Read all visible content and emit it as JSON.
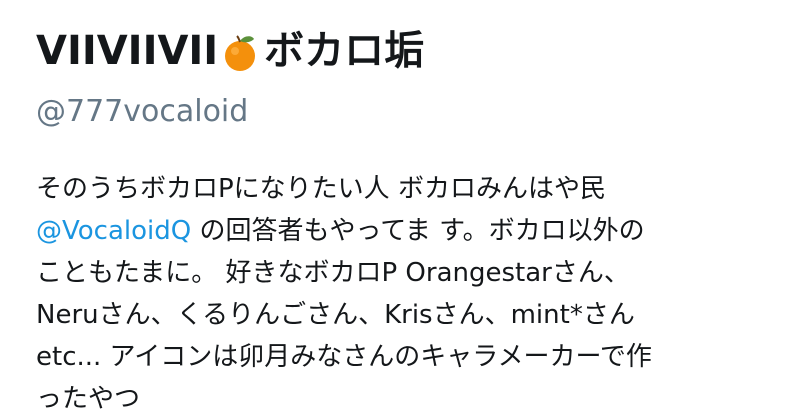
{
  "profile": {
    "name_prefix": "VIIVIIVII",
    "name_suffix": "ボカロ垢",
    "name_emoji": "orange-emoji",
    "handle": "@777vocaloid"
  },
  "bio": {
    "line1": "そのうちボカロPになりたい人 ボカロみんはや民",
    "line2_mention": "@VocaloidQ",
    "line2_rest": " の回答者もやってま す。ボカロ以外の",
    "line3": "こともたまに。 好きなボカロP Orangestarさん、",
    "line4": "Neruさん、くるりんごさん、Krisさん、mint*さん",
    "line5": "etc... アイコンは卯月みなさんのキャラメーカーで作",
    "line6": "ったやつ"
  },
  "colors": {
    "text": "#14171a",
    "handle": "#657786",
    "mention": "#1b95e0"
  }
}
